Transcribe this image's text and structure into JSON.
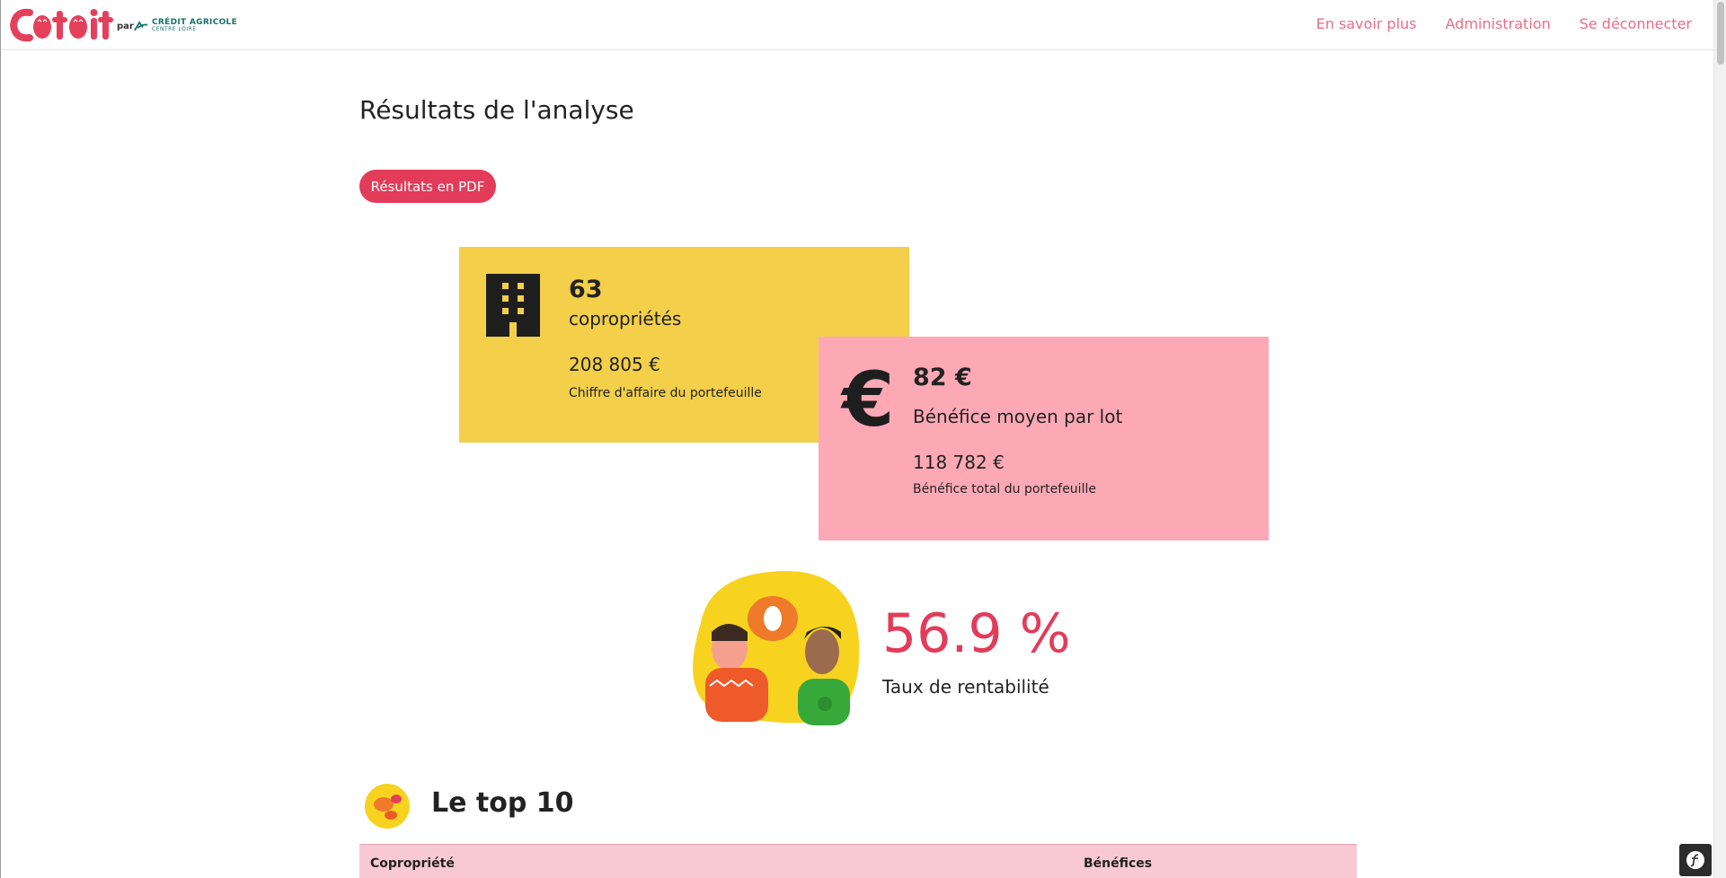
{
  "navbar": {
    "logo_text": "Co toit",
    "logo_par": "par",
    "partner_name": "CRÉDIT AGRICOLE",
    "partner_sub": "CENTRE LOIRE",
    "links": [
      "En savoir plus",
      "Administration",
      "Se déconnecter"
    ]
  },
  "main": {
    "title": "Résultats de l'analyse",
    "pdf_button": "Résultats en PDF"
  },
  "cards": {
    "coproprietes": {
      "value": "63",
      "label": "copropriétés",
      "sub_value": "208 805 €",
      "sub_label": "Chiffre d'affaire du portefeuille",
      "icon": "building-icon",
      "color": "#f3cf4a"
    },
    "benefice": {
      "value": "82 €",
      "label": "Bénéfice moyen par lot",
      "sub_value": "118 782 €",
      "sub_label": "Bénéfice total du portefeuille",
      "icon": "euro-icon",
      "icon_glyph": "€",
      "color": "#fda9b5"
    }
  },
  "rentabilite": {
    "value": "56.9 %",
    "label": "Taux de rentabilité"
  },
  "top10": {
    "title": "Le top 10",
    "columns": [
      "Copropriété",
      "Bénéfices"
    ]
  },
  "colors": {
    "accent": "#e23c5a",
    "nav_link": "#ee6d86",
    "table_header": "#f9c9d3"
  }
}
